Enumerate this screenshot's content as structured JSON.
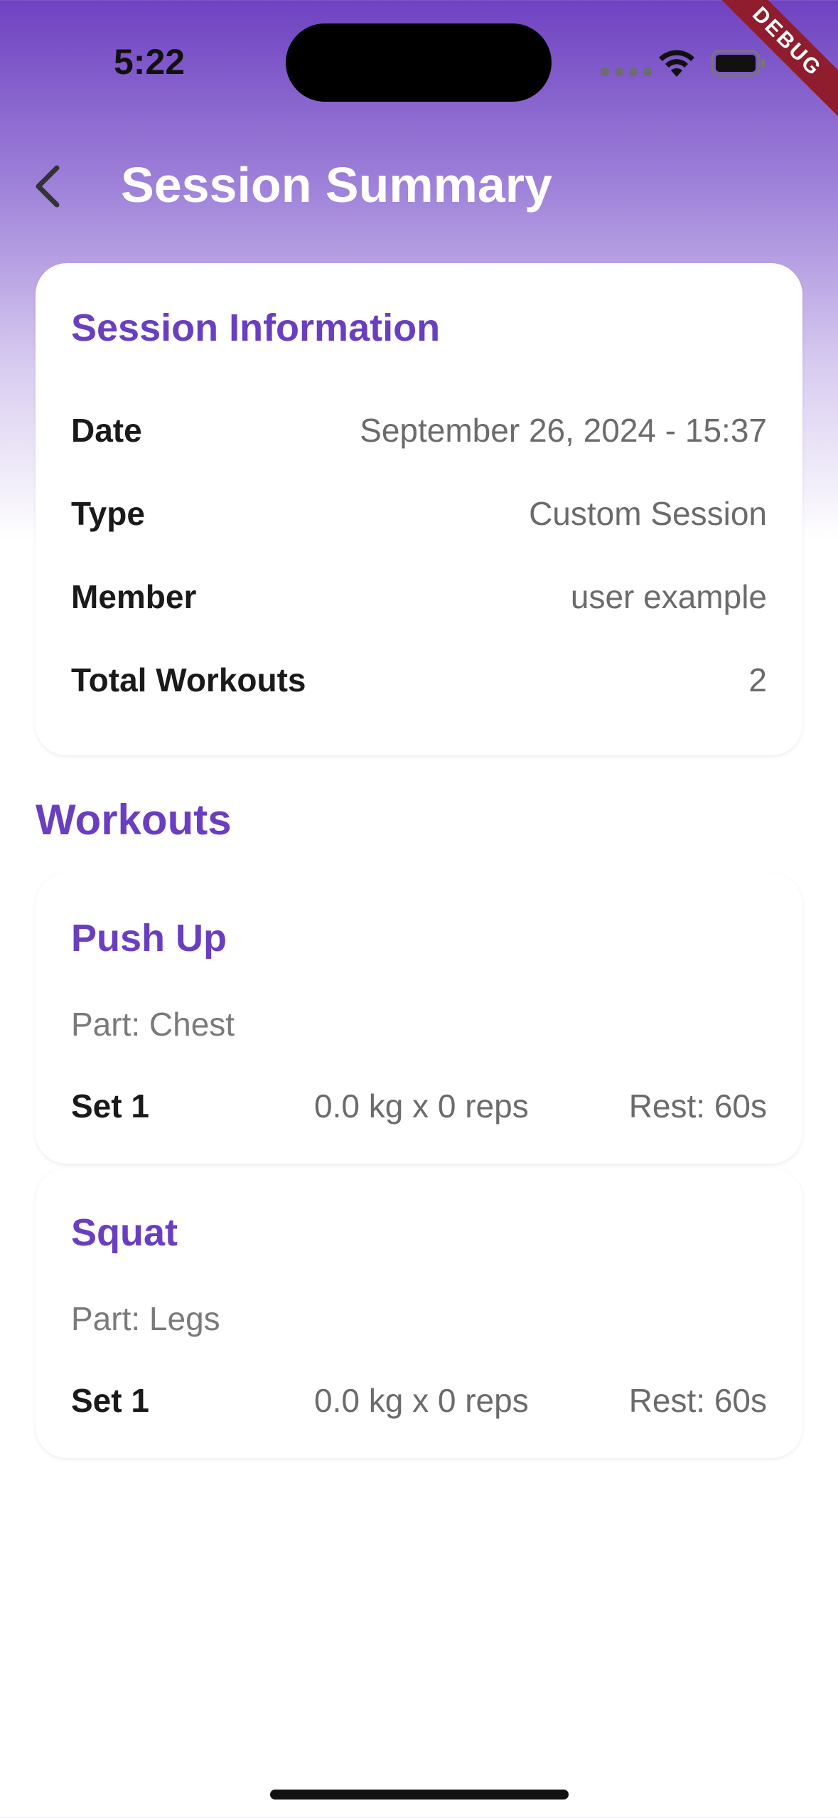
{
  "status_bar": {
    "time": "5:22",
    "debug_label": "DEBUG"
  },
  "header": {
    "title": "Session Summary",
    "back_icon": "chevron-left-icon"
  },
  "session_info": {
    "title": "Session Information",
    "rows": [
      {
        "label": "Date",
        "value": "September 26, 2024 - 15:37"
      },
      {
        "label": "Type",
        "value": "Custom Session"
      },
      {
        "label": "Member",
        "value": "user example"
      },
      {
        "label": "Total Workouts",
        "value": "2"
      }
    ]
  },
  "workouts_section": {
    "heading": "Workouts",
    "items": [
      {
        "name": "Push Up",
        "part": "Part: Chest",
        "set_label": "Set 1",
        "set_detail": "0.0 kg x 0 reps",
        "rest": "Rest: 60s"
      },
      {
        "name": "Squat",
        "part": "Part: Legs",
        "set_label": "Set 1",
        "set_detail": "0.0 kg x 0 reps",
        "rest": "Rest: 60s"
      }
    ]
  },
  "colors": {
    "accent": "#6A3EC0",
    "header_gradient_top": "#6F42C1",
    "background": "#FFFFFF"
  }
}
